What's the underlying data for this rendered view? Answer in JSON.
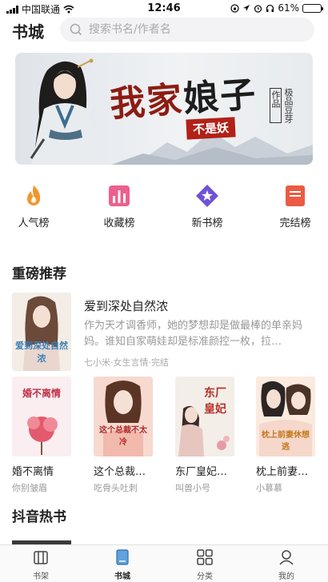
{
  "status": {
    "carrier": "中国联通",
    "time": "12:46",
    "battery_percent": "61%",
    "battery_level": 0.61
  },
  "header": {
    "title": "书城",
    "search_placeholder": "搜索书名/作者名"
  },
  "banner": {
    "title_a": "我家",
    "title_b": "娘子",
    "tag": "不是妖",
    "side_label": "作品",
    "side_brand": "极品豆芽",
    "icon": "banner-artwork"
  },
  "rankings": [
    {
      "label": "人气榜",
      "icon": "flame-icon"
    },
    {
      "label": "收藏榜",
      "icon": "bar-chart-icon"
    },
    {
      "label": "新书榜",
      "icon": "star-badge-icon"
    },
    {
      "label": "完结榜",
      "icon": "document-icon"
    }
  ],
  "sections": {
    "featured_title": "重磅推荐",
    "douyin_title": "抖音热书"
  },
  "featured": {
    "title": "爱到深处自然浓",
    "description": "作为天才调香师，她的梦想却是做最棒的单亲妈妈。谁知自家萌娃却是标准颜控一枚，拉…",
    "meta": "七小米·女生言情·完结",
    "cover_text": "爱到深处自然浓"
  },
  "books": [
    {
      "title": "婚不离情",
      "author": "你别皱眉",
      "cover_text": "婚不离情"
    },
    {
      "title": "这个总裁…",
      "author": "吃骨头吐刺",
      "cover_text": "这个总裁不太冷"
    },
    {
      "title": "东厂皇妃…",
      "author": "叫兽小号",
      "cover_text": "东厂皇妃"
    },
    {
      "title": "枕上前妻…",
      "author": "小慕慕",
      "cover_text": "枕上前妻休想逃"
    }
  ],
  "tabs": [
    {
      "label": "书架",
      "icon": "bookshelf-icon",
      "active": false
    },
    {
      "label": "书城",
      "icon": "book-icon",
      "active": true
    },
    {
      "label": "分类",
      "icon": "grid-icon",
      "active": false
    },
    {
      "label": "我的",
      "icon": "person-icon",
      "active": false
    }
  ],
  "colors": {
    "accent_orange": "#f0962e",
    "accent_pink": "#ee5f8c",
    "accent_purple": "#6f52d6",
    "accent_red": "#ec5b43",
    "active_tab": "#4a8ecf"
  }
}
